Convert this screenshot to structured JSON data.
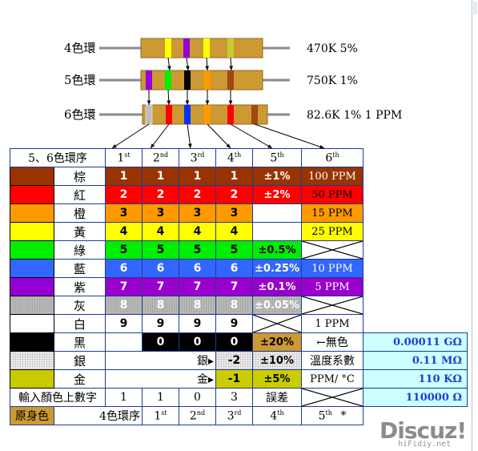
{
  "resistors": [
    {
      "label": "4色環",
      "value_text": "470K  5%",
      "bands": [
        "#ffff00",
        "#9400d3",
        "#ffff00",
        "#c9c933"
      ]
    },
    {
      "label": "5色環",
      "value_text": "750K  1%",
      "bands": [
        "#9400d3",
        "#00ee00",
        "#000000",
        "#ff9900",
        "#9e4a10"
      ]
    },
    {
      "label": "6色環",
      "value_text": "82.6K  1%  1 PPM",
      "bands": [
        "#b0b0b0",
        "#ff0000",
        "#0033ff",
        "#ff9900",
        "#ff0000",
        "#9e4a10",
        "#ffffff"
      ]
    }
  ],
  "table": {
    "header_label": "5、6色環序",
    "ordinals": [
      [
        "1",
        "st"
      ],
      [
        "2",
        "nd"
      ],
      [
        "3",
        "rd"
      ],
      [
        "4",
        "th"
      ],
      [
        "5",
        "th"
      ],
      [
        "6",
        "th"
      ]
    ],
    "rows": [
      {
        "name": "棕",
        "swatch": "#993300",
        "bg": "#993300",
        "fg": "#ffffff",
        "digit": "1",
        "tol": "±1%",
        "ppm": "100 PPM",
        "tol_bg": "#993300",
        "tol_fg": "#ffffff",
        "ppm_bg": "#993300",
        "ppm_fg": "#ffffff"
      },
      {
        "name": "紅",
        "swatch": "#ff0000",
        "bg": "#ff0000",
        "fg": "#ffffff",
        "digit": "2",
        "tol": "±2%",
        "ppm": "50 PPM",
        "tol_bg": "#ff0000",
        "tol_fg": "#ffffff",
        "ppm_bg": "#ff0000",
        "ppm_fg": "#000000"
      },
      {
        "name": "橙",
        "swatch": "#ff9900",
        "bg": "#ff9900",
        "fg": "#000000",
        "digit": "3",
        "tol": "",
        "ppm": "15 PPM",
        "tol_bg": "#ffffff",
        "tol_fg": "#000000",
        "ppm_bg": "#ff9900",
        "ppm_fg": "#000000"
      },
      {
        "name": "黃",
        "swatch": "#ffff00",
        "bg": "#ffff00",
        "fg": "#000000",
        "digit": "4",
        "tol": "",
        "ppm": "25 PPM",
        "tol_bg": "#ffffff",
        "tol_fg": "#000000",
        "ppm_bg": "#ffff00",
        "ppm_fg": "#000000"
      },
      {
        "name": "綠",
        "swatch": "#00ee00",
        "bg": "#00ee00",
        "fg": "#000000",
        "digit": "5",
        "tol": "±0.5%",
        "ppm": "",
        "tol_bg": "#00ee00",
        "tol_fg": "#000000",
        "ppm_bg": "x",
        "ppm_fg": "#000000"
      },
      {
        "name": "藍",
        "swatch": "#3366ff",
        "bg": "#3366ff",
        "fg": "#ffffff",
        "digit": "6",
        "tol": "±0.25%",
        "ppm": "10 PPM",
        "tol_bg": "#3366ff",
        "tol_fg": "#ffffff",
        "ppm_bg": "#3366ff",
        "ppm_fg": "#ffffff"
      },
      {
        "name": "紫",
        "swatch": "#9400d3",
        "bg": "#9900cc",
        "fg": "#ffffff",
        "digit": "7",
        "tol": "±0.1%",
        "ppm": "5 PPM",
        "tol_bg": "#9900cc",
        "tol_fg": "#ffffff",
        "ppm_bg": "#9900cc",
        "ppm_fg": "#ffffff"
      },
      {
        "name": "灰",
        "swatch": "#a9a9a9",
        "bg": "gray",
        "fg": "#ffffff",
        "digit": "8",
        "tol": "±0.05%",
        "ppm": "",
        "tol_bg": "gray",
        "tol_fg": "#ffffff",
        "ppm_bg": "x",
        "ppm_fg": "#000000"
      },
      {
        "name": "白",
        "swatch": "#ffffff",
        "bg": "#ffffff",
        "fg": "#000000",
        "digit": "9",
        "tol": "",
        "ppm": "1 PPM",
        "tol_bg": "x",
        "tol_fg": "#000000",
        "ppm_bg": "#ffffff",
        "ppm_fg": "#000000"
      }
    ],
    "black": {
      "name": "黑",
      "d2": "0",
      "d3": "0",
      "d4": "0",
      "tol": "±20%",
      "note": "←無色",
      "calc": "0.00011 GΩ"
    },
    "silver": {
      "name": "銀",
      "arrow": "銀▸",
      "mult": "-2",
      "tol": "±10%",
      "note": "溫度系數",
      "calc": "0.11 MΩ"
    },
    "gold": {
      "name": "金",
      "arrow": "金▸",
      "mult": "-1",
      "tol": "±5%",
      "note": "PPM/ °C",
      "calc": "110 KΩ"
    },
    "input": {
      "label": "輸入顏色上數字",
      "vals": [
        "1",
        "1",
        "0",
        "3"
      ],
      "err": "誤差",
      "calc": "110000 Ω"
    },
    "footer": {
      "body": "原身色",
      "ring": "4色環序",
      "ords": [
        [
          "1",
          "st"
        ],
        [
          "2",
          "nd"
        ],
        [
          "3",
          "rd"
        ],
        [
          "4",
          "th"
        ],
        [
          "5",
          "th"
        ]
      ],
      "star": "*"
    }
  },
  "watermark": {
    "main": "Discuz!",
    "sub": "hiFidiy.net"
  }
}
